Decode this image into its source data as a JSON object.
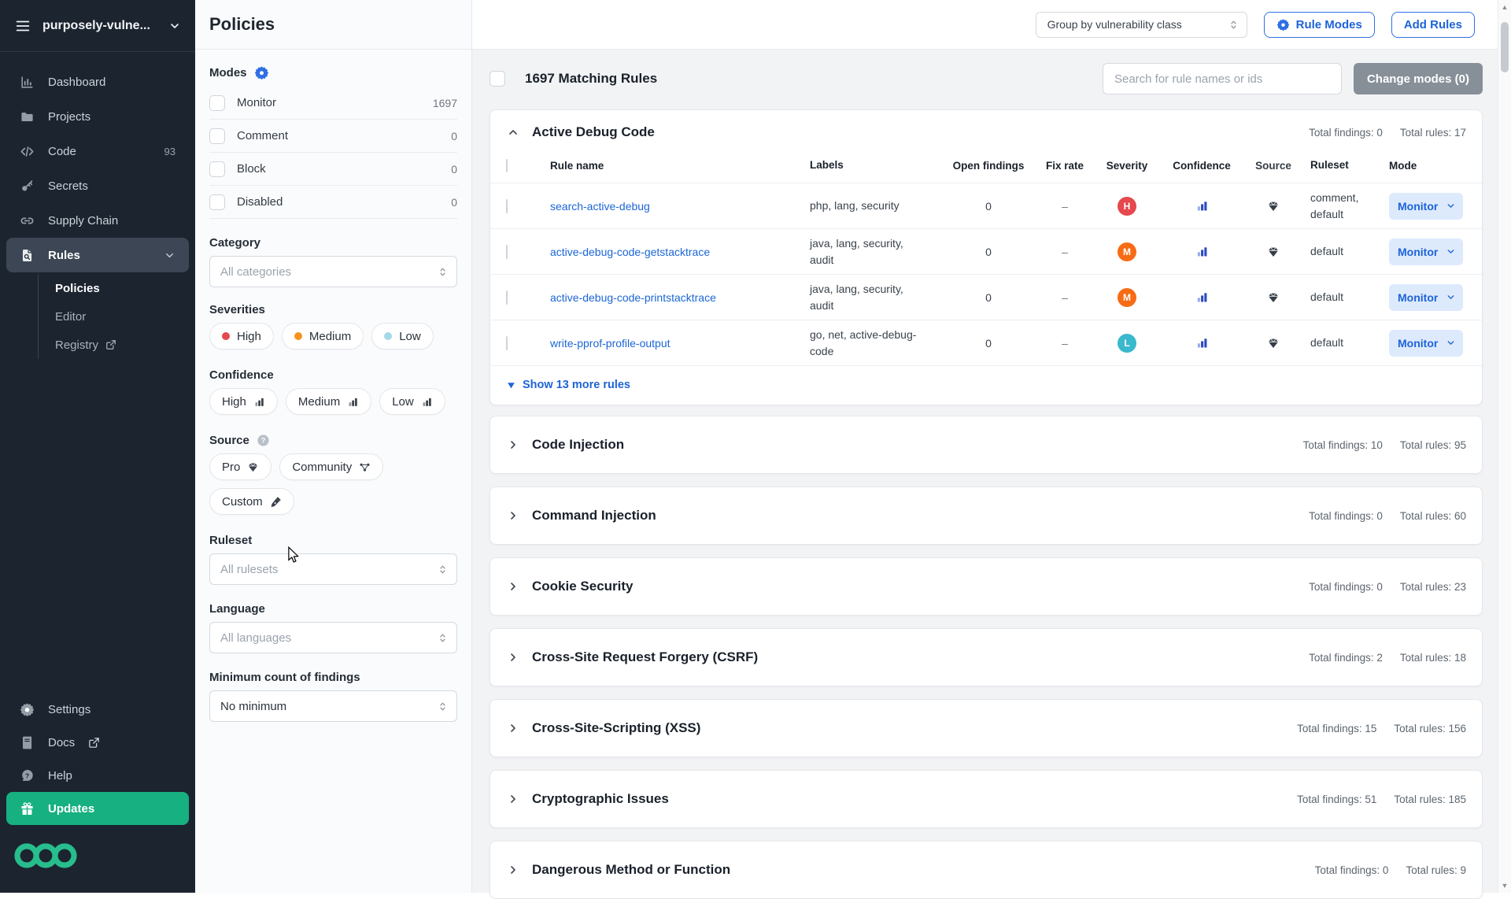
{
  "sidebar": {
    "org": "purposely-vulne...",
    "items": [
      {
        "label": "Dashboard"
      },
      {
        "label": "Projects"
      },
      {
        "label": "Code",
        "badge": "93"
      },
      {
        "label": "Secrets"
      },
      {
        "label": "Supply Chain"
      },
      {
        "label": "Rules"
      }
    ],
    "rules_sub": [
      {
        "label": "Policies"
      },
      {
        "label": "Editor"
      },
      {
        "label": "Registry"
      }
    ],
    "bottom": [
      {
        "label": "Settings"
      },
      {
        "label": "Docs"
      },
      {
        "label": "Help"
      },
      {
        "label": "Updates"
      }
    ]
  },
  "filters": {
    "title": "Policies",
    "modes_label": "Modes",
    "modes": [
      {
        "label": "Monitor",
        "count": "1697"
      },
      {
        "label": "Comment",
        "count": "0"
      },
      {
        "label": "Block",
        "count": "0"
      },
      {
        "label": "Disabled",
        "count": "0"
      }
    ],
    "category_label": "Category",
    "category_placeholder": "All categories",
    "severities_label": "Severities",
    "severity_chips": [
      {
        "label": "High",
        "color": "#e5484d"
      },
      {
        "label": "Medium",
        "color": "#f7941f"
      },
      {
        "label": "Low",
        "color": "#a5d8e9"
      }
    ],
    "confidence_label": "Confidence",
    "confidence_chips": [
      {
        "label": "High"
      },
      {
        "label": "Medium"
      },
      {
        "label": "Low"
      }
    ],
    "source_label": "Source",
    "source_chips": [
      {
        "label": "Pro"
      },
      {
        "label": "Community"
      },
      {
        "label": "Custom"
      }
    ],
    "ruleset_label": "Ruleset",
    "ruleset_placeholder": "All rulesets",
    "language_label": "Language",
    "language_placeholder": "All languages",
    "min_label": "Minimum count of findings",
    "min_value": "No minimum"
  },
  "topbar": {
    "group_by": "Group by vulnerability class",
    "rule_modes": "Rule Modes",
    "add_rules": "Add Rules"
  },
  "main": {
    "matching_title": "1697 Matching Rules",
    "search_placeholder": "Search for rule names or ids",
    "change_modes": "Change modes (0)",
    "findings_label": "Total findings:",
    "rules_label": "Total rules:",
    "table_headers": {
      "name": "Rule name",
      "labels": "Labels",
      "open": "Open findings",
      "fix": "Fix rate",
      "severity": "Severity",
      "confidence": "Confidence",
      "source": "Source",
      "ruleset": "Ruleset",
      "mode": "Mode"
    },
    "rows": [
      {
        "name": "search-active-debug",
        "labels": "php, lang, security",
        "open": "0",
        "fix": "–",
        "severity": "H",
        "severity_color": "#e5484d",
        "ruleset": "comment, default",
        "mode": "Monitor"
      },
      {
        "name": "active-debug-code-getstacktrace",
        "labels": "java, lang, security, audit",
        "open": "0",
        "fix": "–",
        "severity": "M",
        "severity_color": "#f76b15",
        "ruleset": "default",
        "mode": "Monitor"
      },
      {
        "name": "active-debug-code-printstacktrace",
        "labels": "java, lang, security, audit",
        "open": "0",
        "fix": "–",
        "severity": "M",
        "severity_color": "#f76b15",
        "ruleset": "default",
        "mode": "Monitor"
      },
      {
        "name": "write-pprof-profile-output",
        "labels": "go, net, active-debug-code",
        "open": "0",
        "fix": "–",
        "severity": "L",
        "severity_color": "#3ab8cd",
        "ruleset": "default",
        "mode": "Monitor"
      }
    ],
    "show_more": "Show 13 more rules",
    "groups": [
      {
        "title": "Active Debug Code",
        "findings": "0",
        "rules": "17"
      },
      {
        "title": "Code Injection",
        "findings": "10",
        "rules": "95"
      },
      {
        "title": "Command Injection",
        "findings": "0",
        "rules": "60"
      },
      {
        "title": "Cookie Security",
        "findings": "0",
        "rules": "23"
      },
      {
        "title": "Cross-Site Request Forgery (CSRF)",
        "findings": "2",
        "rules": "18"
      },
      {
        "title": "Cross-Site-Scripting (XSS)",
        "findings": "15",
        "rules": "156"
      },
      {
        "title": "Cryptographic Issues",
        "findings": "51",
        "rules": "185"
      },
      {
        "title": "Dangerous Method or Function",
        "findings": "0",
        "rules": "9"
      }
    ]
  }
}
